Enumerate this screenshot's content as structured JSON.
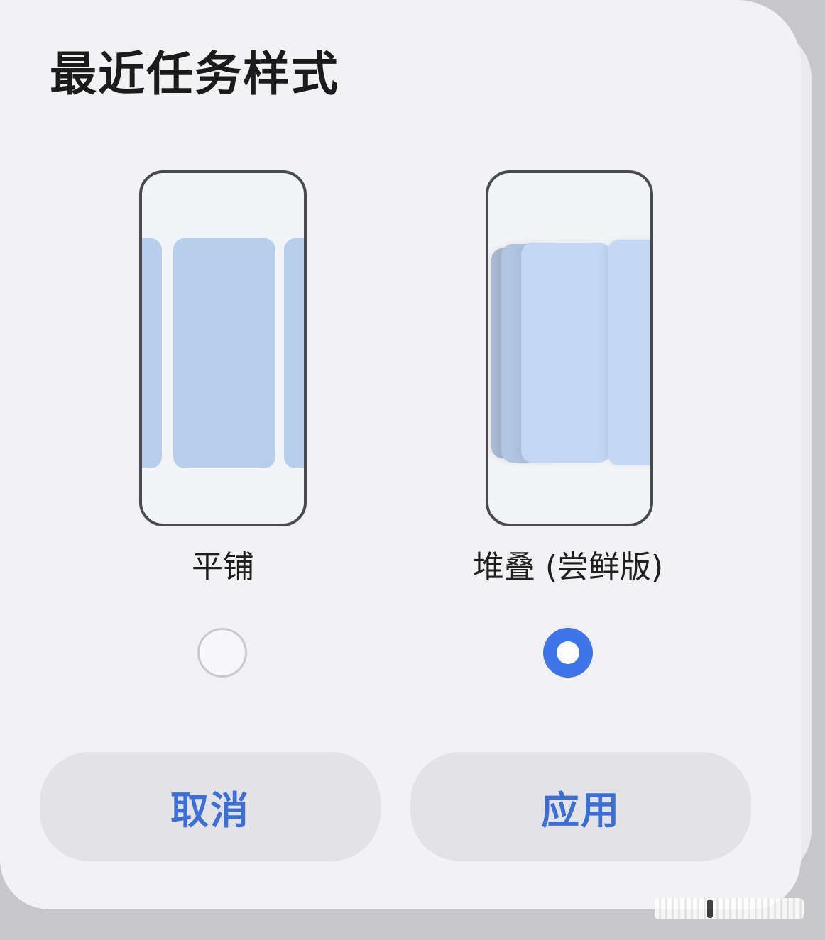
{
  "dialog": {
    "title": "最近任务样式",
    "options": [
      {
        "label": "平铺",
        "selected": false
      },
      {
        "label": "堆叠 (尝鲜版)",
        "selected": true
      }
    ],
    "buttons": {
      "cancel": "取消",
      "apply": "应用"
    }
  },
  "colors": {
    "accent": "#3f74e8",
    "button_text": "#3c6fd6",
    "dialog_bg": "#f2f2f4",
    "pane_blue": "#b7ceed"
  }
}
